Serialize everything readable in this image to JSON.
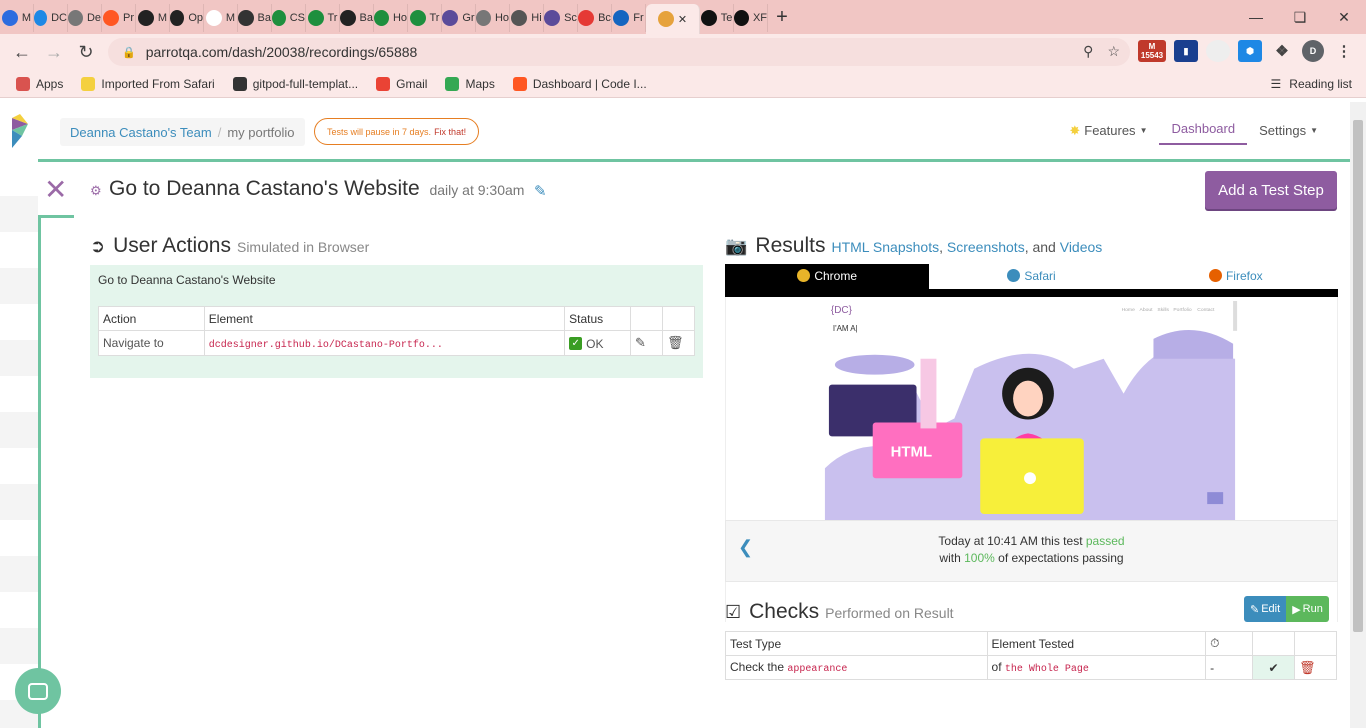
{
  "browser": {
    "tabs": [
      {
        "label": "M",
        "color": "#2d6cdf"
      },
      {
        "label": "DC",
        "color": "#1e88e5"
      },
      {
        "label": "De",
        "color": "#777"
      },
      {
        "label": "Pr",
        "color": "#ff5722"
      },
      {
        "label": "M",
        "color": "#222"
      },
      {
        "label": "Op",
        "color": "#222"
      },
      {
        "label": "M",
        "color": "#fff"
      },
      {
        "label": "Ba",
        "color": "#333"
      },
      {
        "label": "CS",
        "color": "#1e8f3e"
      },
      {
        "label": "Tr",
        "color": "#1e8f3e"
      },
      {
        "label": "Ba",
        "color": "#222"
      },
      {
        "label": "Ho",
        "color": "#1e8f3e"
      },
      {
        "label": "Tr",
        "color": "#1e8f3e"
      },
      {
        "label": "Gr",
        "color": "#5b4b9a"
      },
      {
        "label": "Ho",
        "color": "#777"
      },
      {
        "label": "Hi",
        "color": "#555"
      },
      {
        "label": "Sc",
        "color": "#5b4b9a"
      },
      {
        "label": "Bc",
        "color": "#e53935"
      },
      {
        "label": "Fr",
        "color": "#1565c0"
      },
      {
        "label": "",
        "color": "#e6a23c",
        "active": true
      },
      {
        "label": "Te",
        "color": "#111"
      },
      {
        "label": "XF",
        "color": "#111"
      }
    ],
    "url": "parrotqa.com/dash/20038/recordings/65888",
    "gmail_badge": "15543",
    "profile_initial": "D",
    "bookmarks": [
      {
        "label": "Apps",
        "color": "#d9534f"
      },
      {
        "label": "Imported From Safari",
        "color": "#f4d03f"
      },
      {
        "label": "gitpod-full-templat...",
        "color": "#333"
      },
      {
        "label": "Gmail",
        "color": "#ea4335"
      },
      {
        "label": "Maps",
        "color": "#34a853"
      },
      {
        "label": "Dashboard | Code I...",
        "color": "#ff5722"
      }
    ],
    "reading_list": "Reading list"
  },
  "header": {
    "team": "Deanna Castano's Team",
    "separator": "/",
    "project": "my portfolio",
    "pause_text": "Tests will pause in 7 days.",
    "pause_fix": "Fix that!",
    "nav": {
      "features": "Features",
      "dashboard": "Dashboard",
      "settings": "Settings"
    }
  },
  "test": {
    "title": "Go to Deanna Castano's Website",
    "schedule": "daily at 9:30am",
    "add_step": "Add a Test Step"
  },
  "user_actions": {
    "heading": "User Actions",
    "subheading": "Simulated in Browser",
    "step_name": "Go to Deanna Castano's Website",
    "columns": [
      "Action",
      "Element",
      "Status"
    ],
    "rows": [
      {
        "action": "Navigate to",
        "element": "dcdesigner.github.io/DCastano-Portfo...",
        "status": "OK"
      }
    ]
  },
  "results": {
    "heading": "Results",
    "link_html": "HTML Snapshots",
    "comma": ",",
    "link_screens": "Screenshots",
    "and": ", and",
    "link_videos": "Videos",
    "browsers": [
      {
        "name": "Chrome",
        "color": "#e8b429",
        "active": true
      },
      {
        "name": "Safari",
        "color": "#3c8dbc"
      },
      {
        "name": "Firefox",
        "color": "#e66000"
      }
    ],
    "snapshot": {
      "logo": "{DC}",
      "tagline": "I'AM A|",
      "nav": [
        "Home",
        "About",
        "Skills",
        "Portfolio",
        "Contact"
      ],
      "badge": "HTML"
    },
    "summary_time": "Today at 10:41 AM",
    "summary_mid": "this test",
    "summary_status": "passed",
    "summary_with": "with",
    "summary_pct": "100%",
    "summary_tail": "of expectations passing"
  },
  "checks": {
    "heading": "Checks",
    "subheading": "Performed on Result",
    "edit": "Edit",
    "run": "Run",
    "columns": [
      "Test Type",
      "Element Tested"
    ],
    "rows": [
      {
        "type_prefix": "Check the",
        "type_code": "appearance",
        "el_prefix": "of",
        "el_code": "the Whole Page",
        "timer": "-"
      }
    ]
  }
}
